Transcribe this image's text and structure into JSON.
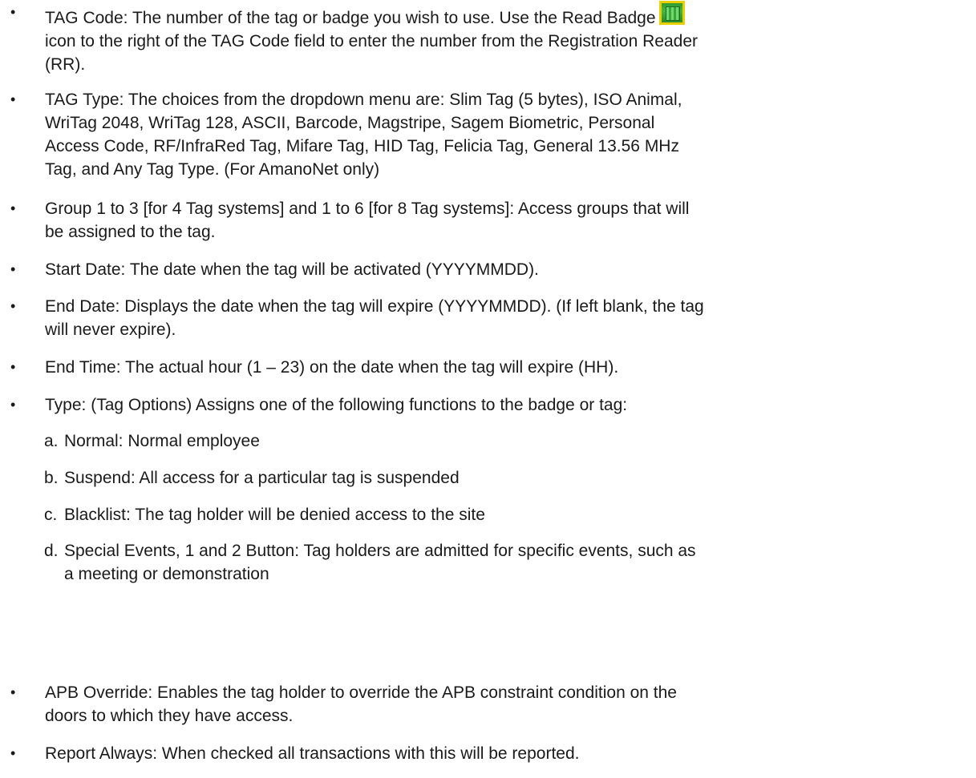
{
  "items": [
    {
      "id": "tag-code",
      "lines": [
        "TAG Code: The number of the tag or badge you wish to use. Use the Read Badge",
        "icon to the right of the TAG Code field to enter the number from the Registration Reader",
        "(RR)."
      ],
      "icon": "read-badge-icon"
    },
    {
      "id": "tag-type",
      "lines": [
        "TAG Type: The choices from the dropdown menu are: Slim Tag (5 bytes), ISO Animal,",
        "WriTag 2048, WriTag 128, ASCII, Barcode, Magstripe, Sagem Biometric, Personal",
        "Access Code, RF/InfraRed Tag, Mifare Tag, HID Tag, Felicia Tag, General 13.56 MHz",
        "Tag, and Any Tag Type. (For AmanoNet only)"
      ]
    },
    {
      "id": "group",
      "lines": [
        "Group 1 to 3 [for 4 Tag systems] and 1 to 6 [for 8 Tag systems]: Access groups that will",
        "be assigned to the tag."
      ]
    },
    {
      "id": "start-date",
      "lines": [
        "Start Date: The date when the tag will be activated (YYYYMMDD)."
      ]
    },
    {
      "id": "end-date",
      "lines": [
        "End Date: Displays the date when the tag will expire (YYYYMMDD). (If left blank, the tag",
        "will never expire)."
      ]
    },
    {
      "id": "end-time",
      "lines": [
        "End Time: The actual hour (1 – 23) on the date when the tag will expire (HH)."
      ]
    },
    {
      "id": "type",
      "lines": [
        "Type: (Tag Options) Assigns one of the following functions to the badge or tag:"
      ],
      "sub_items": [
        {
          "marker": "a.",
          "lines": [
            "Normal: Normal employee"
          ]
        },
        {
          "marker": "b.",
          "lines": [
            "Suspend: All access for a particular tag is suspended"
          ]
        },
        {
          "marker": "c.",
          "lines": [
            "Blacklist: The tag holder will be denied access to the site"
          ]
        },
        {
          "marker": "d.",
          "lines": [
            "Special Events, 1 and 2 Button: Tag holders are admitted for specific events, such as",
            "a meeting or demonstration"
          ]
        }
      ]
    },
    {
      "id": "apb-override",
      "lines": [
        "APB Override: Enables the tag holder to override the APB constraint condition on the",
        "doors to which they have access."
      ]
    },
    {
      "id": "report-always",
      "lines": [
        "Report Always: When checked all transactions with this will be reported."
      ]
    }
  ],
  "bullet_glyph": "•"
}
